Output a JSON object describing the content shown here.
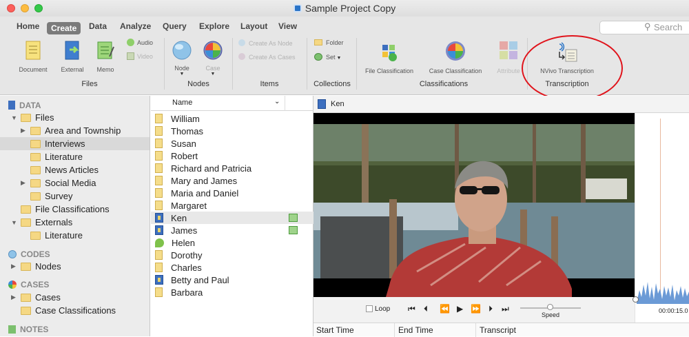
{
  "window": {
    "title": "Sample Project Copy"
  },
  "menu": [
    "Home",
    "Create",
    "Data",
    "Analyze",
    "Query",
    "Explore",
    "Layout",
    "View"
  ],
  "search": {
    "placeholder": "Search"
  },
  "ribbon": {
    "files": {
      "document": "Document",
      "external": "External",
      "memo": "Memo",
      "audio": "Audio",
      "video": "Video",
      "group": "Files"
    },
    "nodes": {
      "node": "Node",
      "case": "Case",
      "group": "Nodes"
    },
    "items": {
      "create_as_node": "Create As Node",
      "create_as_cases": "Create As Cases",
      "group": "Items"
    },
    "collections": {
      "folder": "Folder",
      "set": "Set",
      "group": "Collections"
    },
    "classifications": {
      "file": "File Classification",
      "case": "Case Classification",
      "attribute": "Attribute",
      "group": "Classifications"
    },
    "transcription": {
      "nvivo": "NVivo Transcription",
      "group": "Transcription"
    }
  },
  "sidebar": {
    "data_section": "DATA",
    "files": "Files",
    "area": "Area and Township",
    "interviews": "Interviews",
    "literature": "Literature",
    "news": "News Articles",
    "social": "Social Media",
    "survey": "Survey",
    "file_class": "File Classifications",
    "externals": "Externals",
    "ext_literature": "Literature",
    "codes_section": "CODES",
    "nodes": "Nodes",
    "cases_section": "CASES",
    "cases": "Cases",
    "case_class": "Case Classifications",
    "notes_section": "NOTES"
  },
  "list": {
    "header": "Name",
    "items": [
      "William",
      "Thomas",
      "Susan",
      "Robert",
      "Richard and Patricia",
      "Mary and James",
      "Maria and Daniel",
      "Margaret",
      "Ken",
      "James",
      "Helen",
      "Dorothy",
      "Charles",
      "Betty and Paul",
      "Barbara"
    ]
  },
  "viewer": {
    "title": "Ken",
    "loop": "Loop",
    "speed": "Speed",
    "timecode": "00:00:15.0",
    "columns": [
      "Start Time",
      "End Time",
      "Transcript"
    ]
  }
}
